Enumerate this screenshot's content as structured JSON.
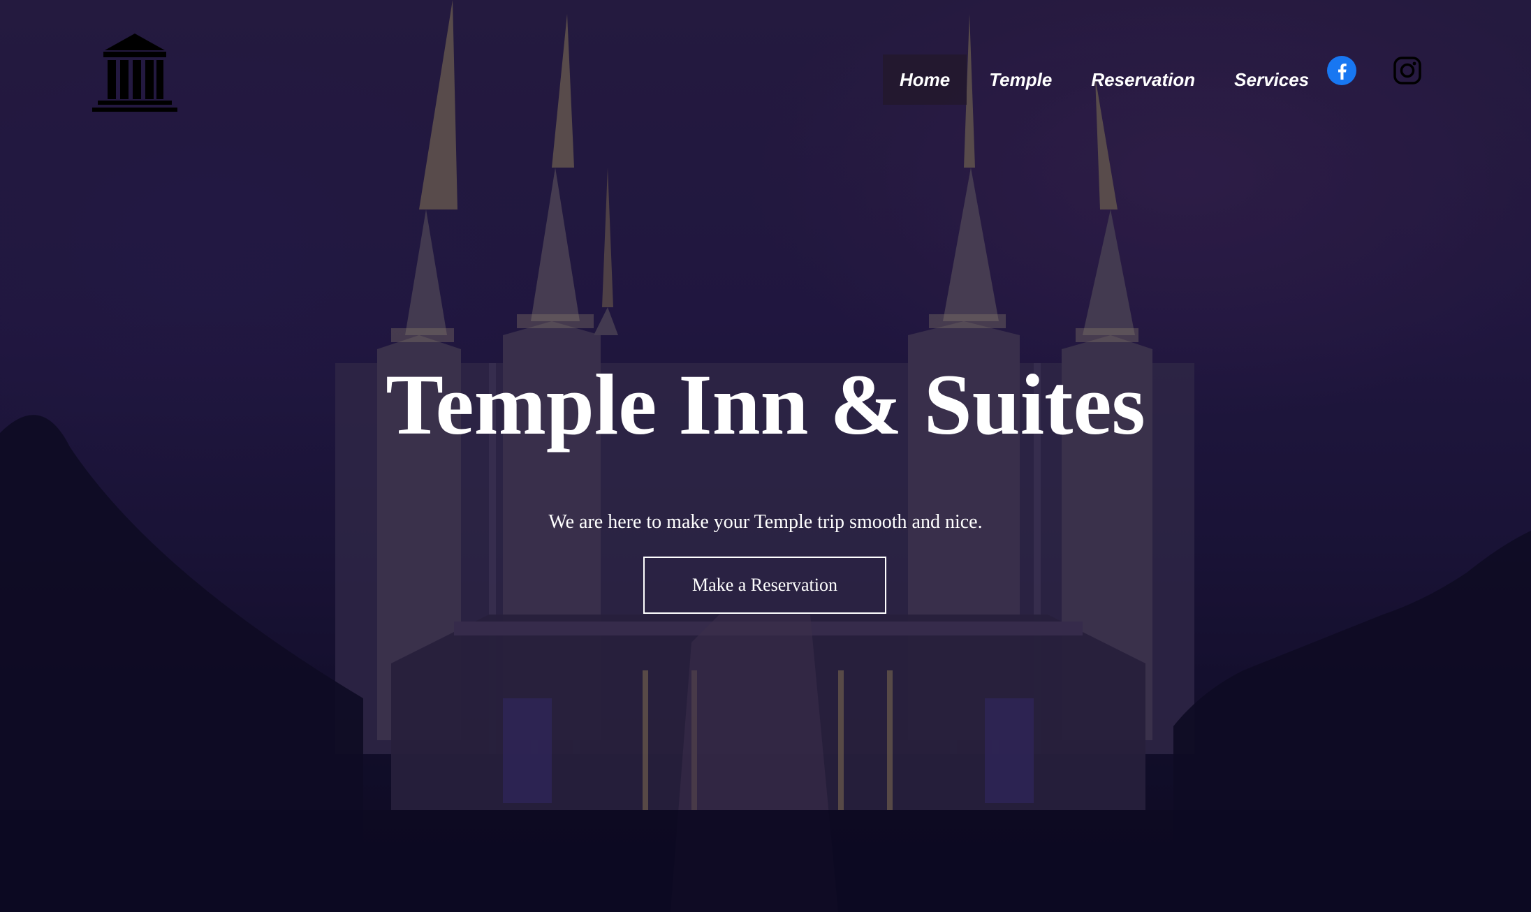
{
  "nav": {
    "items": [
      {
        "label": "Home",
        "active": true
      },
      {
        "label": "Temple",
        "active": false
      },
      {
        "label": "Reservation",
        "active": false
      },
      {
        "label": "Services",
        "active": false
      }
    ],
    "social": [
      {
        "icon": "facebook-icon",
        "color": "#1877F2"
      },
      {
        "icon": "instagram-icon",
        "color": "#000000"
      }
    ]
  },
  "logo": {
    "icon": "temple-building-icon",
    "color": "#000000"
  },
  "hero": {
    "title": "Temple Inn & Suites",
    "subtitle": "We are here to make your Temple trip smooth and nice.",
    "cta_label": "Make a Reservation"
  }
}
